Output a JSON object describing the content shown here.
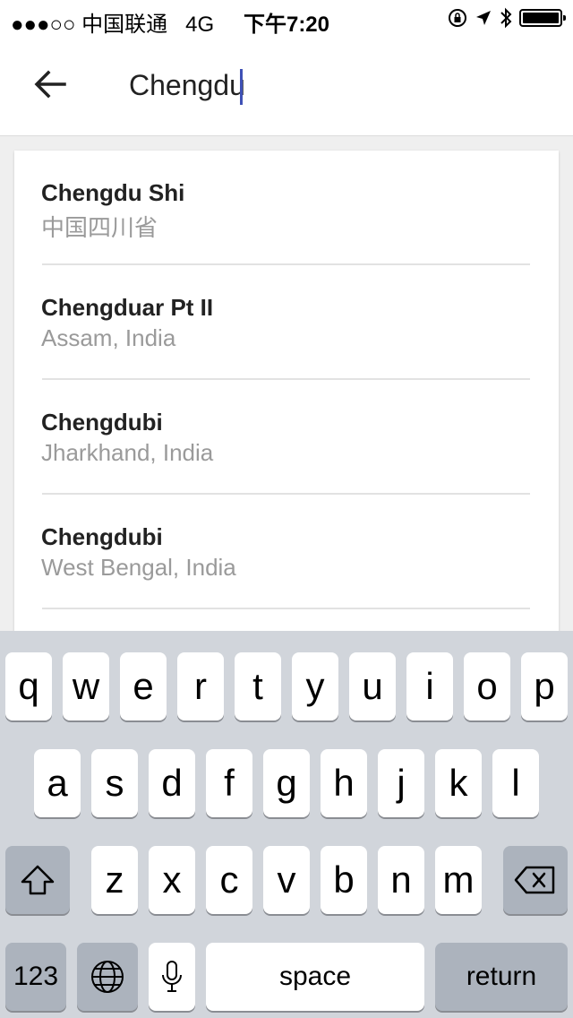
{
  "status_bar": {
    "carrier": "●●●○○ 中国联通",
    "network": "4G",
    "time": "下午7:20"
  },
  "header": {
    "back_icon": "arrow-back-icon",
    "search_value": "Chengdu",
    "accent_color": "#3f51b5"
  },
  "results": [
    {
      "name": "Chengdu Shi",
      "region": "中国四川省"
    },
    {
      "name": "Chengduar Pt II",
      "region": "Assam, India"
    },
    {
      "name": "Chengdubi",
      "region": "Jharkhand, India"
    },
    {
      "name": "Chengdubi",
      "region": "West Bengal, India"
    }
  ],
  "keyboard": {
    "row1": [
      "q",
      "w",
      "e",
      "r",
      "t",
      "y",
      "u",
      "i",
      "o",
      "p"
    ],
    "row2": [
      "a",
      "s",
      "d",
      "f",
      "g",
      "h",
      "j",
      "k",
      "l"
    ],
    "row3": [
      "z",
      "x",
      "c",
      "v",
      "b",
      "n",
      "m"
    ],
    "numbers_label": "123",
    "space_label": "space",
    "return_label": "return",
    "shift_icon": "shift-icon",
    "delete_icon": "backspace-icon",
    "globe_icon": "globe-icon",
    "mic_icon": "microphone-icon"
  }
}
